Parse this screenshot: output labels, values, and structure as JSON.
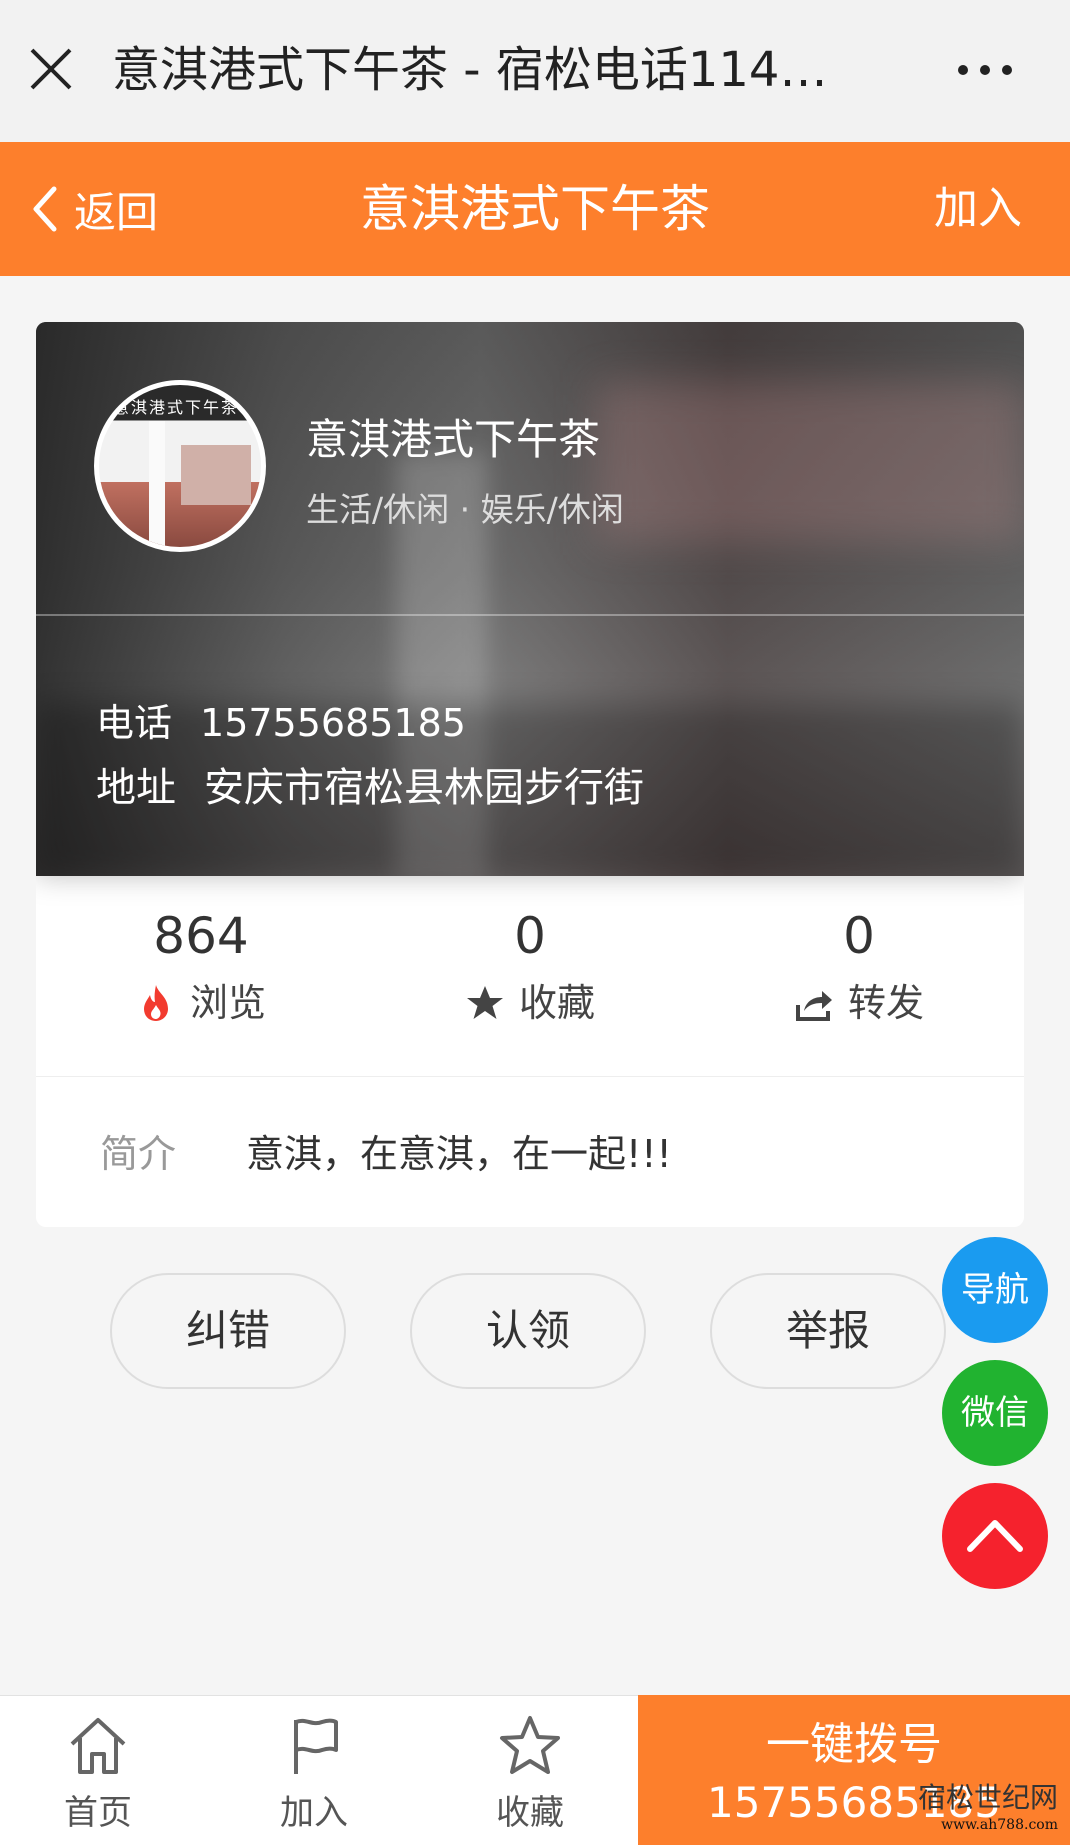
{
  "wechat": {
    "title": "意淇港式下午茶 - 宿松电话114…"
  },
  "header": {
    "back_label": "返回",
    "title": "意淇港式下午茶",
    "join_label": "加入"
  },
  "shop": {
    "name": "意淇港式下午茶",
    "categories": "生活/休闲 · 娱乐/休闲",
    "phone_label": "电话",
    "phone": "15755685185",
    "address_label": "地址",
    "address": "安庆市宿松县林园步行街",
    "avatar_sign": "意淇港式下午茶"
  },
  "stats": [
    {
      "value": "864",
      "label": "浏览",
      "icon": "fire-icon"
    },
    {
      "value": "0",
      "label": "收藏",
      "icon": "star-icon"
    },
    {
      "value": "0",
      "label": "转发",
      "icon": "share-icon"
    }
  ],
  "intro": {
    "label": "简介",
    "text": "意淇，在意淇，在一起!!!"
  },
  "actions": [
    "纠错",
    "认领",
    "举报"
  ],
  "floating": {
    "nav": "导航",
    "wechat": "微信"
  },
  "bottom_tabs": [
    {
      "label": "首页",
      "icon": "home-icon"
    },
    {
      "label": "加入",
      "icon": "flag-icon"
    },
    {
      "label": "收藏",
      "icon": "star-outline-icon"
    }
  ],
  "dial": {
    "title": "一键拨号",
    "number": "15755685185"
  },
  "watermark": {
    "main": "宿松世纪网",
    "url": "www.ah788.com"
  },
  "colors": {
    "brand_orange": "#fd7f2c",
    "nav_blue": "#1a9bf0",
    "wechat_green": "#21b330",
    "top_red": "#f5222d",
    "fire_red": "#f23b2f"
  }
}
